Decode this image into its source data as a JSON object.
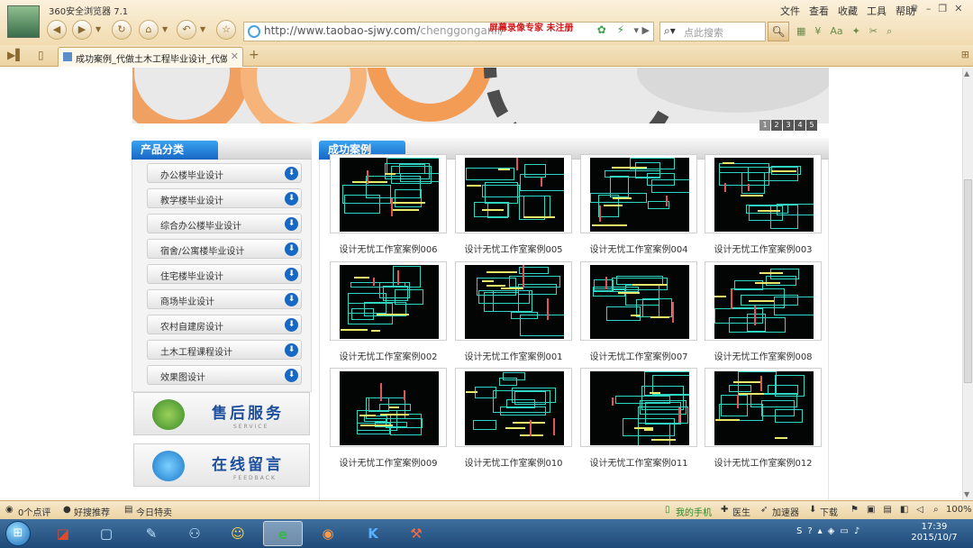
{
  "browser": {
    "app_title": "360安全浏览器 7.1",
    "url": "http://www.taobao-sjwy.com/",
    "url_path": "chenggonganli/",
    "watermark": "屏幕录像专家  未注册",
    "search_placeholder": "点此搜索",
    "menu": [
      "文件",
      "查看",
      "收藏",
      "工具",
      "帮助"
    ],
    "tab_title": "成功案例_代做土木工程毕业设计_代做建筑",
    "nav_icons": [
      "back-icon",
      "forward-icon",
      "refresh-icon",
      "home-icon",
      "undo-icon",
      "favorite-icon"
    ]
  },
  "page": {
    "slide_pages": [
      "1",
      "2",
      "3",
      "4",
      "5"
    ],
    "category_panel": {
      "title": "产品分类",
      "items": [
        "办公楼毕业设计",
        "教学楼毕业设计",
        "综合办公楼毕业设计",
        "宿舍/公寓楼毕业设计",
        "住宅楼毕业设计",
        "商场毕业设计",
        "农村自建房设计",
        "土木工程课程设计",
        "效果图设计"
      ]
    },
    "service": {
      "after_sales_title": "售后服务",
      "after_sales_sub": "SERVICE",
      "message_title": "在线留言",
      "message_sub": "FEEDBACK"
    },
    "cases_panel": {
      "title": "成功案例",
      "items": [
        "设计无忧工作室案例006",
        "设计无忧工作室案例005",
        "设计无忧工作室案例004",
        "设计无忧工作室案例003",
        "设计无忧工作室案例002",
        "设计无忧工作室案例001",
        "设计无忧工作室案例007",
        "设计无忧工作室案例008",
        "设计无忧工作室案例009",
        "设计无忧工作室案例010",
        "设计无忧工作室案例011",
        "设计无忧工作室案例012"
      ]
    }
  },
  "statusbar": {
    "comments": "0个点评",
    "recommend": "好搜推荐",
    "daily": "今日特卖",
    "phone": "我的手机",
    "doctor": "医生",
    "accelerator": "加速器",
    "download": "下载",
    "zoom": "100%"
  },
  "taskbar": {
    "time": "17:39",
    "date": "2015/10/7",
    "apps": [
      "360-icon",
      "window-icon",
      "pencil-icon",
      "network-icon",
      "qq-icon",
      "browser-icon",
      "recorder-icon",
      "k-icon",
      "tool-icon"
    ]
  },
  "colors": {
    "browser_chrome": "#f1dbb0",
    "panel_blue": "#1767c4",
    "cad_cyan": "#2fd6c3",
    "watermark_red": "#d01818"
  }
}
